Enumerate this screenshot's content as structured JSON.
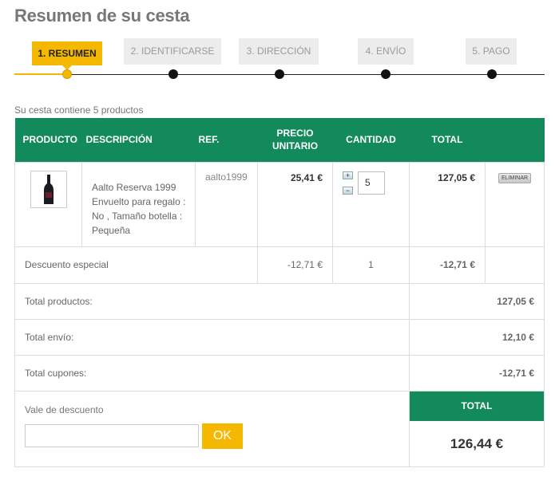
{
  "page": {
    "title": "Resumen de su cesta"
  },
  "steps": [
    {
      "label": "1. RESUMEN",
      "active": true
    },
    {
      "label": "2. IDENTIFICARSE",
      "active": false
    },
    {
      "label": "3. DIRECCIÓN",
      "active": false
    },
    {
      "label": "4. ENVÍO",
      "active": false
    },
    {
      "label": "5. PAGO",
      "active": false
    }
  ],
  "cart": {
    "summary": "Su cesta contiene 5 productos",
    "columns": {
      "product": "PRODUCTO",
      "description": "DESCRIPCIÓN",
      "ref": "REF.",
      "unit_price": "PRECIO UNITARIO",
      "quantity": "CANTIDAD",
      "total": "TOTAL"
    },
    "items": [
      {
        "description": "Aalto Reserva 1999 Envuelto para regalo : No , Tamaño botella : Pequeña",
        "ref": "aalto1999",
        "unit_price": "25,41 €",
        "quantity": "5",
        "total": "127,05 €",
        "delete_label": "ELIMINAR",
        "image_icon": "wine-bottle-icon"
      }
    ],
    "discount": {
      "label": "Descuento especial",
      "unit_price": "-12,71 €",
      "quantity": "1",
      "total": "-12,71 €"
    },
    "totals": {
      "products_label": "Total productos:",
      "products_value": "127,05 €",
      "shipping_label": "Total envío:",
      "shipping_value": "12,10 €",
      "coupons_label": "Total cupones:",
      "coupons_value": "-12,71 €"
    },
    "voucher": {
      "label": "Vale de descuento",
      "value": "",
      "button_label": "OK"
    },
    "grand_total": {
      "label": "TOTAL",
      "value": "126,44 €"
    }
  },
  "colors": {
    "accent": "#f5b800",
    "header_green": "#128a5c"
  }
}
